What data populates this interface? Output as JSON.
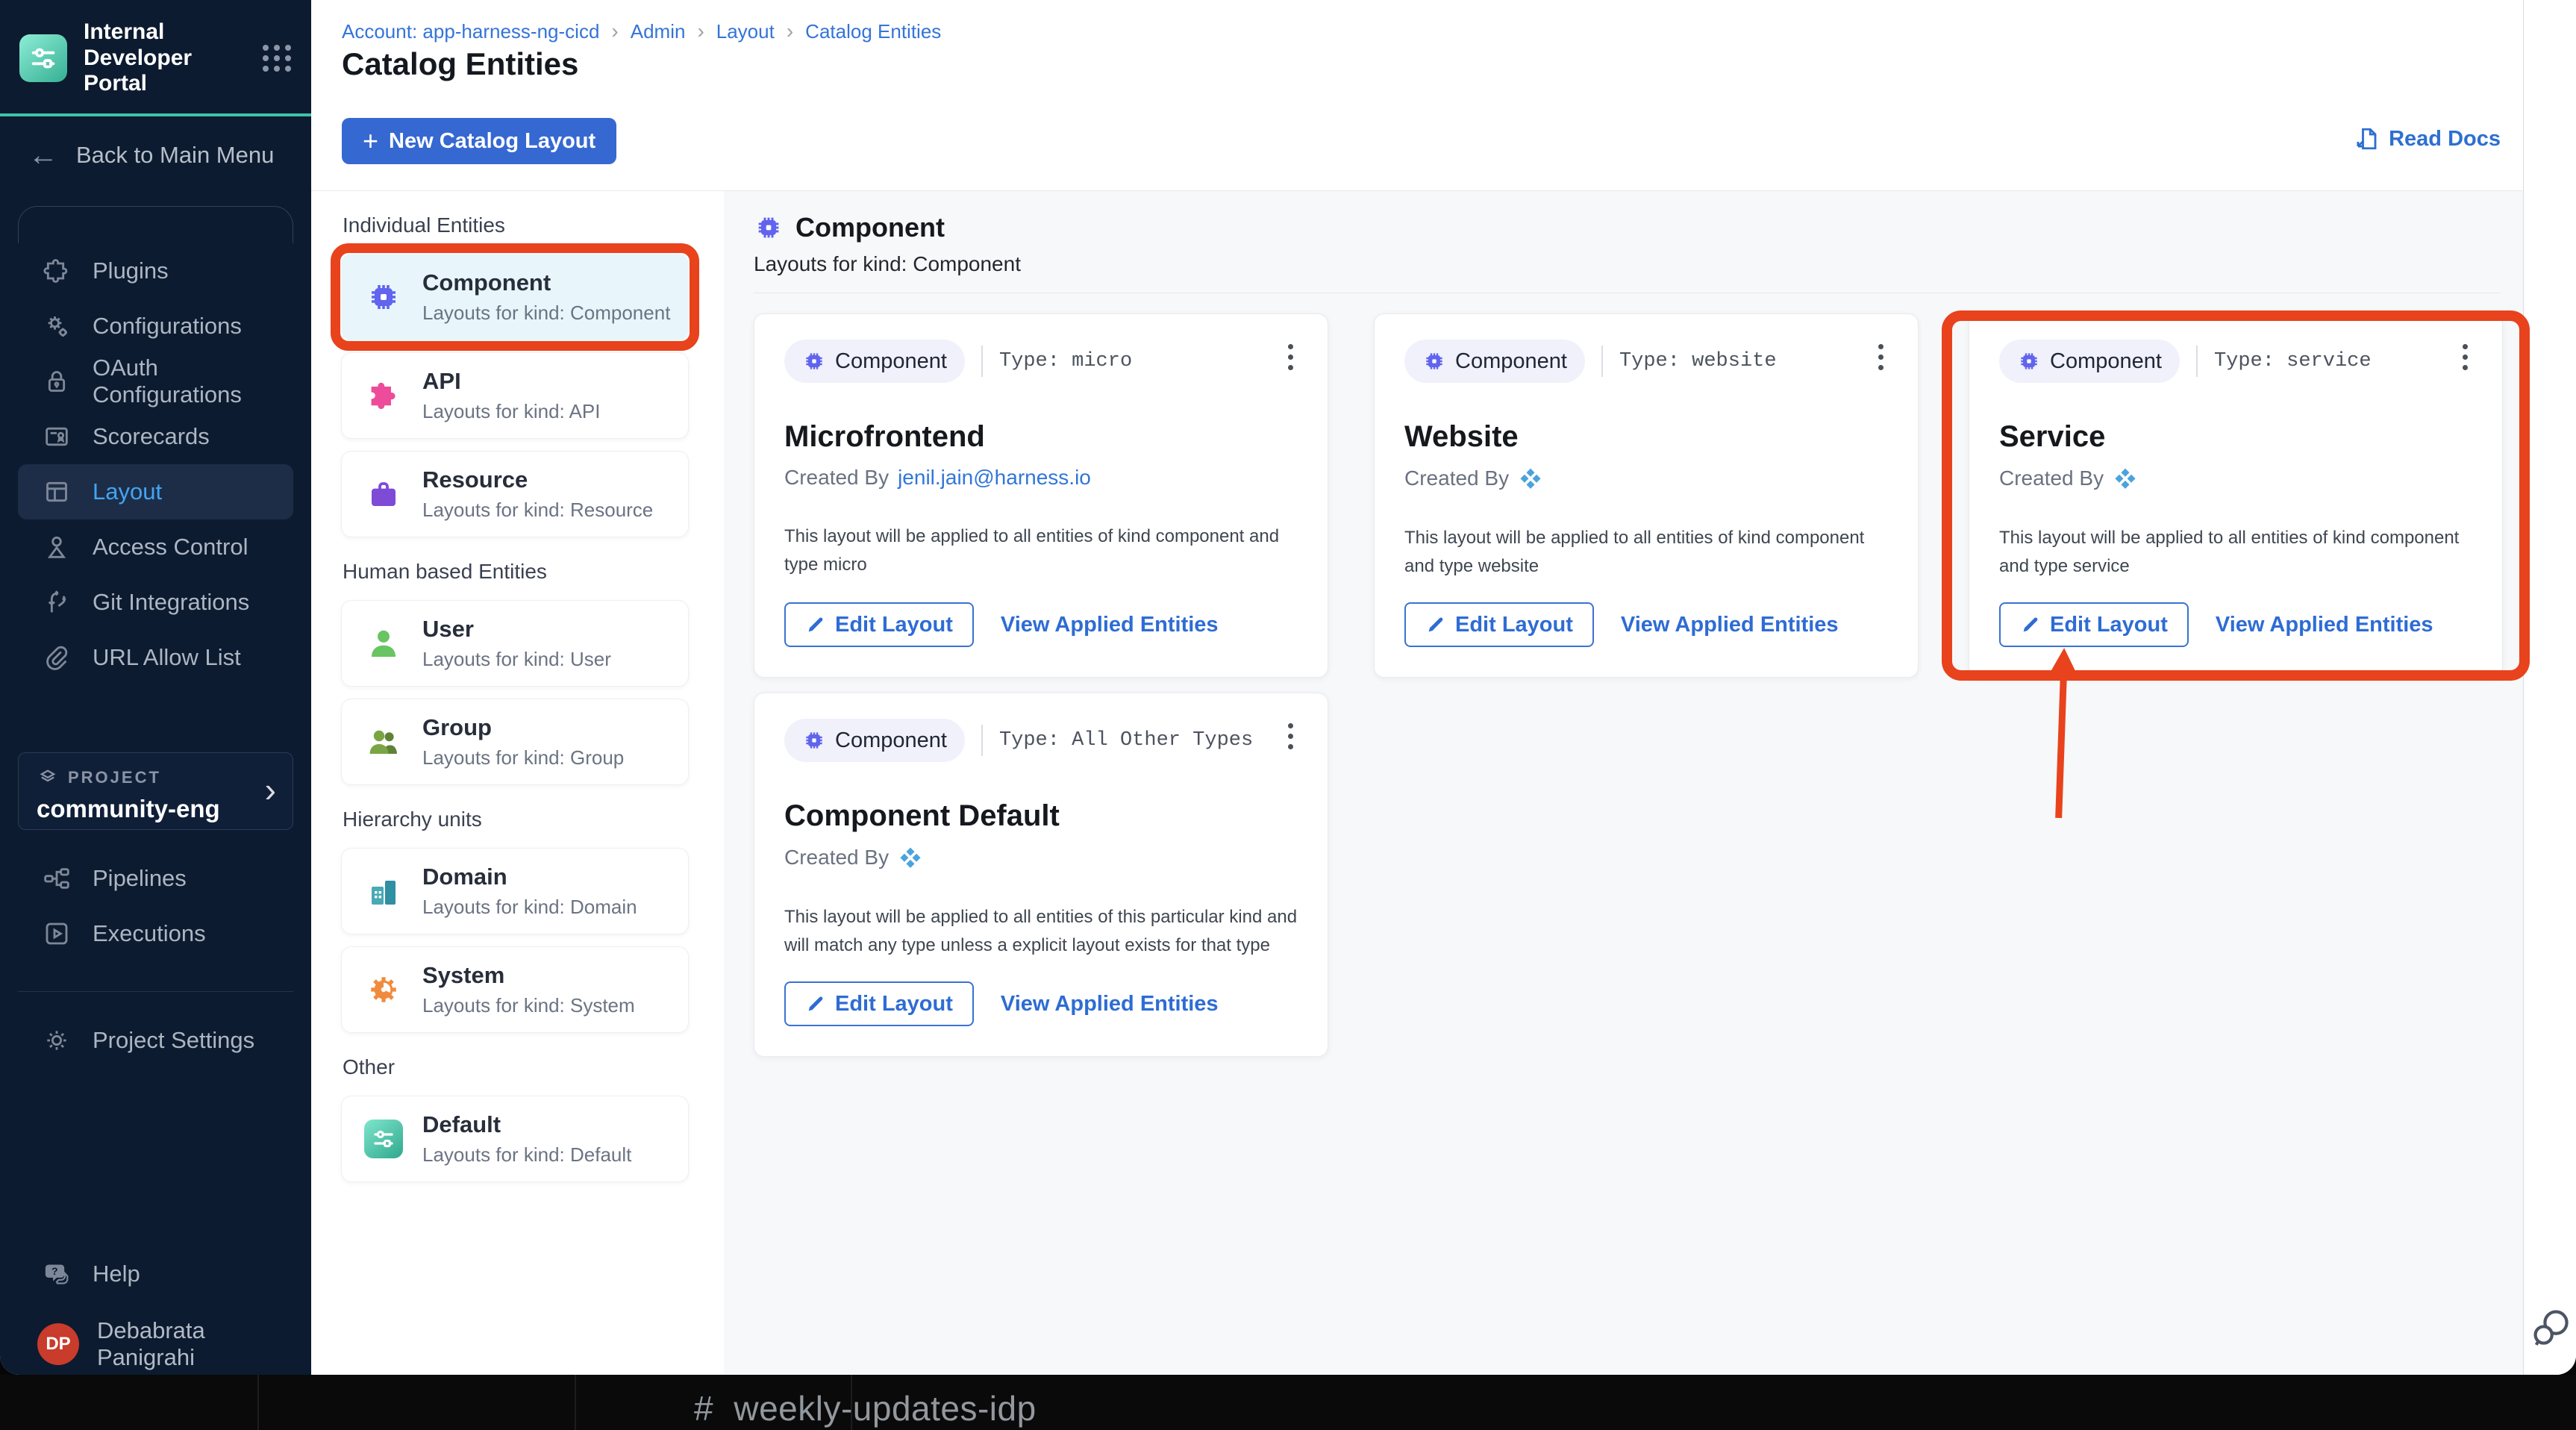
{
  "window": {
    "brand": "Internal Developer Portal",
    "back_label": "Back to Main Menu"
  },
  "sidebar": {
    "nav": [
      {
        "label": "Plugins"
      },
      {
        "label": "Configurations"
      },
      {
        "label": "OAuth Configurations"
      },
      {
        "label": "Scorecards"
      },
      {
        "label": "Layout",
        "active": true
      },
      {
        "label": "Access Control"
      },
      {
        "label": "Git Integrations"
      },
      {
        "label": "URL Allow List"
      }
    ],
    "project": {
      "eyebrow": "PROJECT",
      "name": "community-eng",
      "chevron": "›"
    },
    "secondary": [
      {
        "label": "Pipelines"
      },
      {
        "label": "Executions"
      }
    ],
    "settings_label": "Project Settings",
    "help_label": "Help",
    "user": {
      "initials": "DP",
      "name": "Debabrata Panigrahi"
    }
  },
  "header": {
    "breadcrumb": [
      {
        "label": "Account: app-harness-ng-cicd"
      },
      {
        "label": "Admin"
      },
      {
        "label": "Layout"
      },
      {
        "label": "Catalog Entities"
      }
    ],
    "breadcrumb_separator": "›",
    "title": "Catalog Entities",
    "new_layout_plus": "+",
    "new_layout_button": "New Catalog Layout",
    "read_docs_label": "Read Docs"
  },
  "entity_panel": {
    "sections": [
      {
        "heading": "Individual Entities",
        "items": [
          {
            "name": "Component",
            "subtitle": "Layouts for kind: Component",
            "selected": true,
            "annotated": true
          },
          {
            "name": "API",
            "subtitle": "Layouts for kind: API"
          },
          {
            "name": "Resource",
            "subtitle": "Layouts for kind: Resource"
          }
        ]
      },
      {
        "heading": "Human based Entities",
        "items": [
          {
            "name": "User",
            "subtitle": "Layouts for kind: User"
          },
          {
            "name": "Group",
            "subtitle": "Layouts for kind: Group"
          }
        ]
      },
      {
        "heading": "Hierarchy units",
        "items": [
          {
            "name": "Domain",
            "subtitle": "Layouts for kind: Domain"
          },
          {
            "name": "System",
            "subtitle": "Layouts for kind: System"
          }
        ]
      },
      {
        "heading": "Other",
        "items": [
          {
            "name": "Default",
            "subtitle": "Layouts for kind: Default"
          }
        ]
      }
    ]
  },
  "main": {
    "kind_title": "Component",
    "kind_subtitle": "Layouts for kind: Component",
    "created_by_label": "Created By",
    "cards": [
      {
        "badge": "Component",
        "type_label": "Type: micro",
        "title": "Microfrontend",
        "created_by": "jenil.jain@harness.io",
        "description": "This layout will be applied to all entities of kind component and type micro",
        "edit_label": "Edit Layout",
        "view_label": "View Applied Entities"
      },
      {
        "badge": "Component",
        "type_label": "Type: website",
        "title": "Website",
        "description": "This layout will be applied to all entities of kind component and type website",
        "edit_label": "Edit Layout",
        "view_label": "View Applied Entities"
      },
      {
        "badge": "Component",
        "type_label": "Type: service",
        "title": "Service",
        "annotated": true,
        "description": "This layout will be applied to all entities of kind component and type service",
        "edit_label": "Edit Layout",
        "view_label": "View Applied Entities"
      },
      {
        "badge": "Component",
        "type_label": "Type: All Other Types",
        "title": "Component Default",
        "description": "This layout will be applied to all entities of this particular kind and will match any type unless a explicit layout exists for that type",
        "edit_label": "Edit Layout",
        "view_label": "View Applied Entities"
      }
    ]
  },
  "background_window": {
    "channel": "# weekly-updates-idp"
  },
  "colors": {
    "sidebar_bg": "#0c1b2f",
    "teal_accent": "#3ec3aa",
    "active_nav_blue": "#41a5f3",
    "link_blue": "#3474d8",
    "primary_button_blue": "#3668d2",
    "chip_indigo": "#6064ee",
    "annotation_red": "#e8431c",
    "selected_item_bg": "#e8f6fb",
    "avatar_red": "#c93b2b",
    "api_pink": "#ed4c9a",
    "resource_purple": "#7d4bd6",
    "user_green": "#69c462",
    "group_olive": "#7ba544",
    "domain_teal": "#3d9fb0",
    "system_orange": "#f08b3e"
  }
}
